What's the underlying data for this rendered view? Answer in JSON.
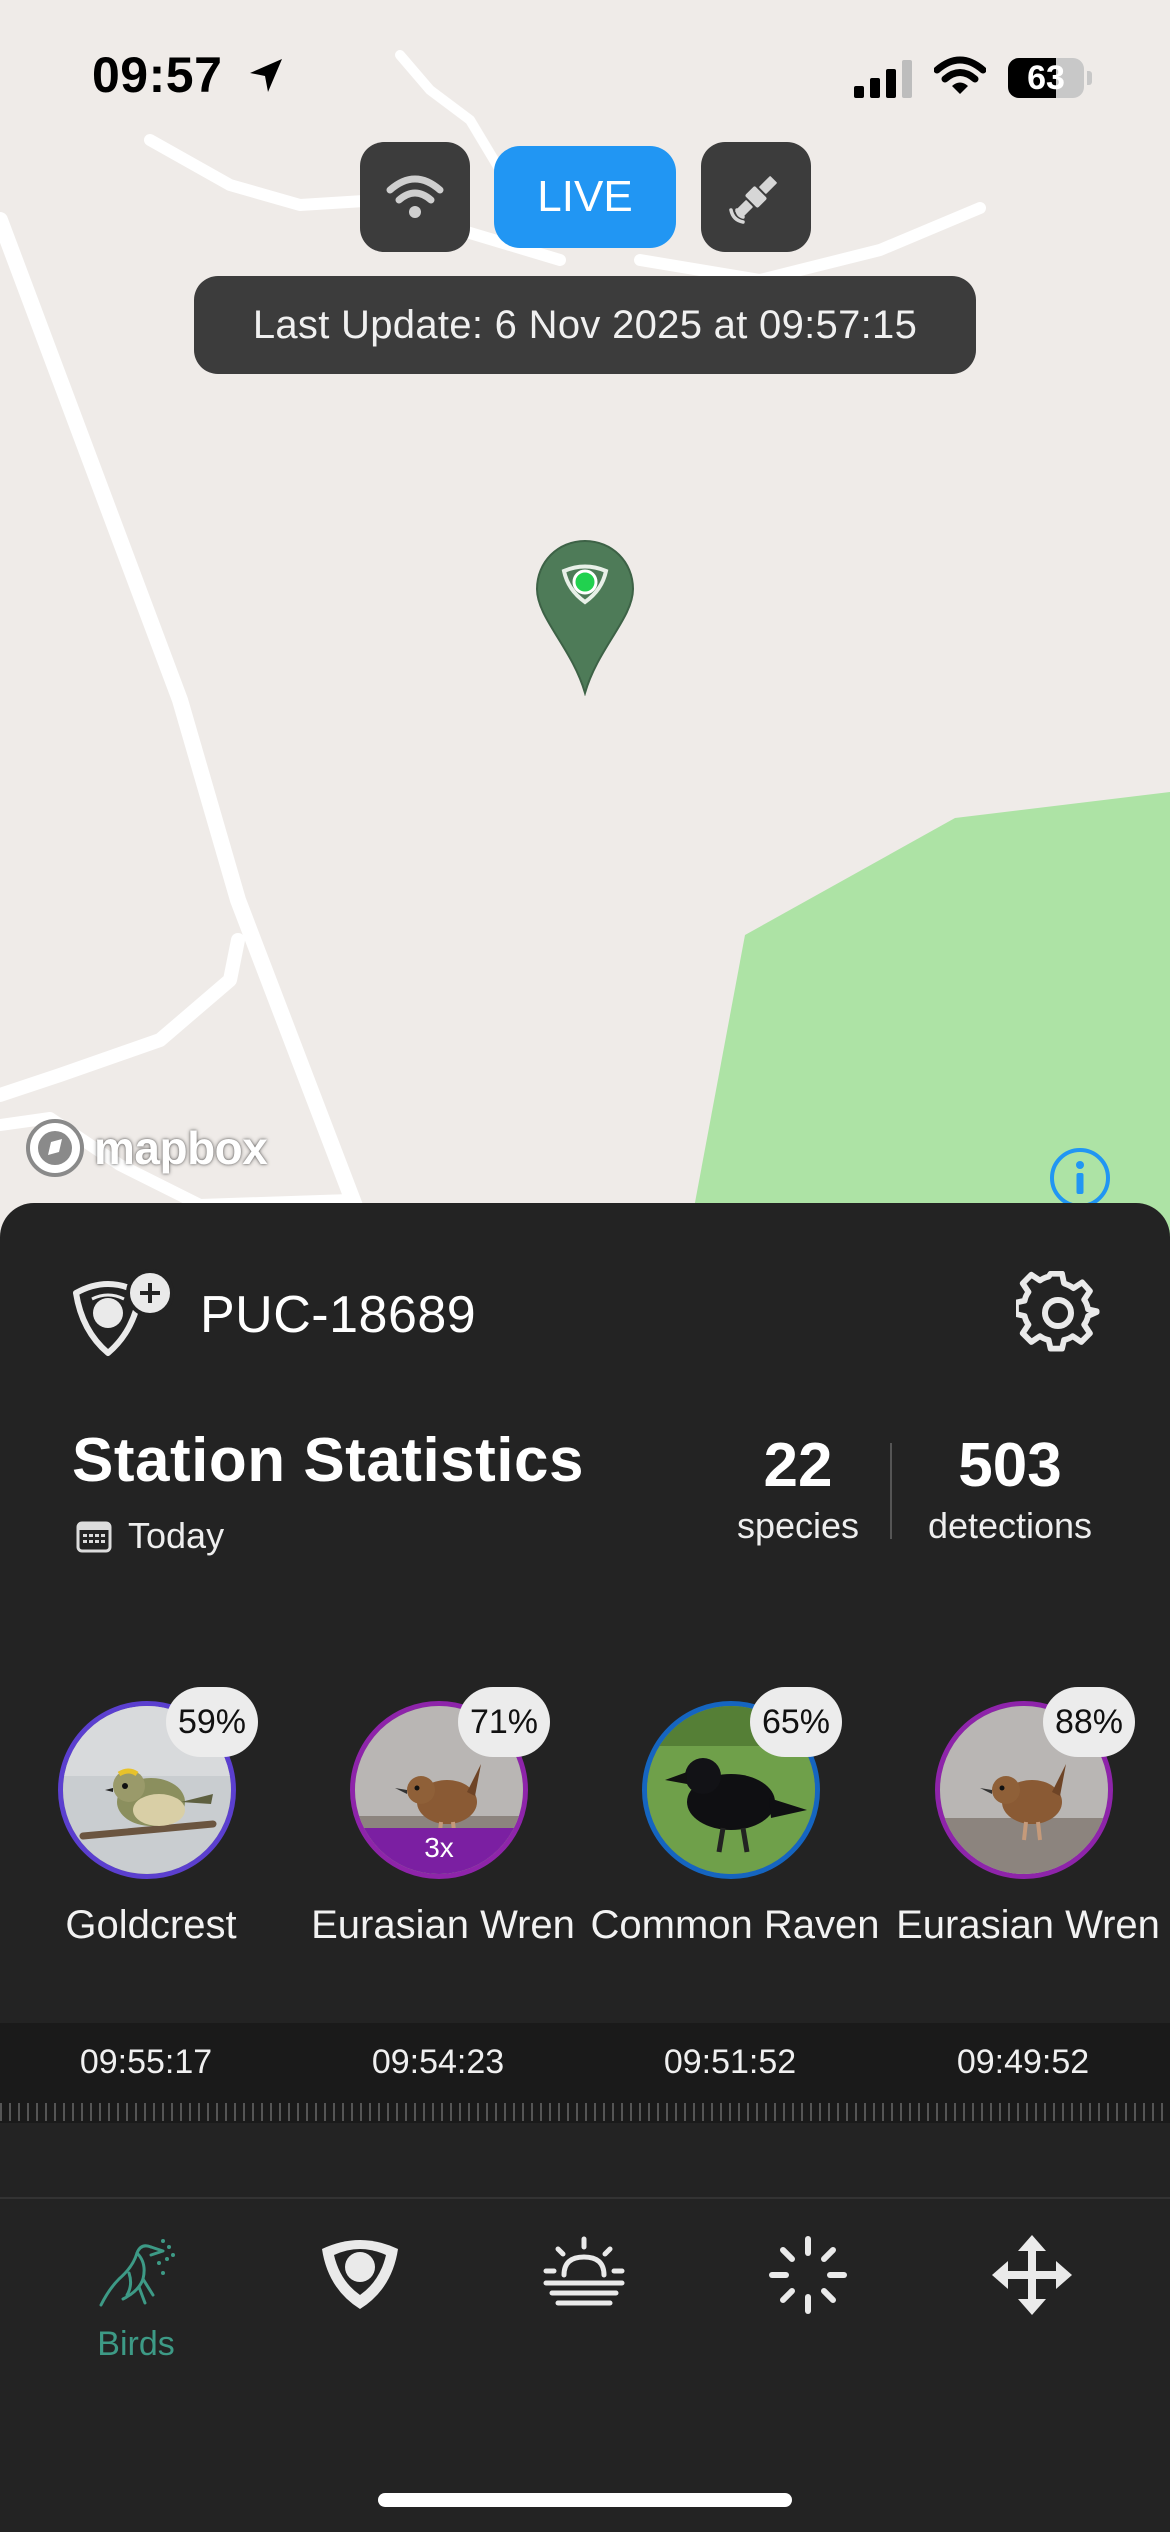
{
  "status_bar": {
    "time": "09:57",
    "battery_percent": "63",
    "battery_level": 0.63
  },
  "map": {
    "mode_live_label": "LIVE",
    "last_update": "Last Update: 6 Nov 2025 at 09:57:15",
    "attribution_logo": "mapbox",
    "colors": {
      "background": "#efebe8",
      "park": "#ade3a5",
      "pin": "#4e7b58",
      "live_button": "#2196f3"
    }
  },
  "station": {
    "name": "PUC-18689"
  },
  "stats": {
    "title": "Station Statistics",
    "period": "Today",
    "species_count": "22",
    "species_label": "species",
    "detections_count": "503",
    "detections_label": "detections"
  },
  "detections": [
    {
      "name": "Goldcrest",
      "confidence": "59%",
      "time": "09:55:17",
      "ring_color": "#5b3fcf",
      "count": ""
    },
    {
      "name": "Eurasian Wren",
      "confidence": "71%",
      "time": "09:54:23",
      "ring_color": "#8e24aa",
      "count": "3x"
    },
    {
      "name": "Common Raven",
      "confidence": "65%",
      "time": "09:51:52",
      "ring_color": "#1565c0",
      "count": ""
    },
    {
      "name": "Eurasian Wren",
      "confidence": "88%",
      "time": "09:49:52",
      "ring_color": "#8e24aa",
      "count": ""
    }
  ],
  "tabs": [
    {
      "label": "Birds",
      "icon": "bird-icon",
      "active": true
    },
    {
      "label": "",
      "icon": "station-icon"
    },
    {
      "label": "",
      "icon": "sunrise-icon"
    },
    {
      "label": "",
      "icon": "activity-icon"
    },
    {
      "label": "",
      "icon": "move-icon"
    }
  ]
}
